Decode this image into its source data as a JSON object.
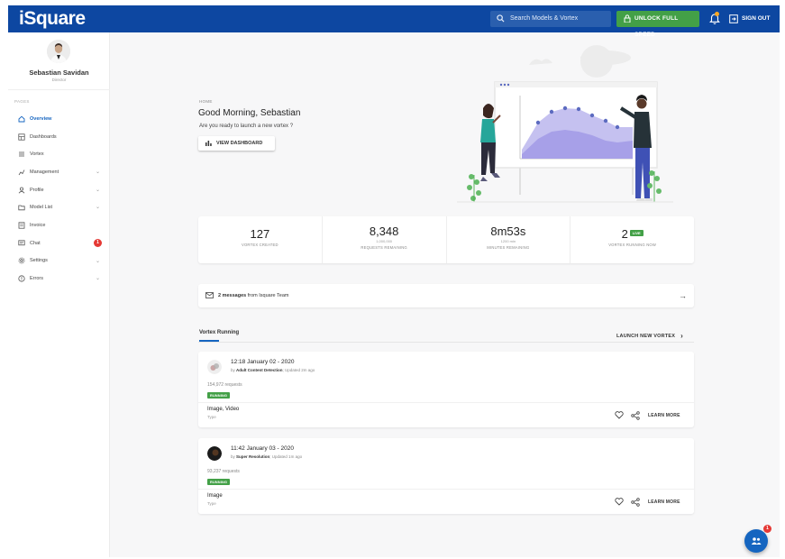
{
  "app": {
    "logo": "iSquare"
  },
  "topbar": {
    "search_placeholder": "Search Models & Vortex",
    "unlock_label": "UNLOCK FULL SPEED",
    "signout_label": "SIGN OUT",
    "colors": {
      "bar": "#0d47a1",
      "unlock": "#43a047"
    }
  },
  "user": {
    "name": "Sebastian Savidan",
    "role": "Director"
  },
  "sidebar": {
    "section_label": "PAGES",
    "items": [
      {
        "label": "Overview",
        "icon": "home-icon",
        "active": true
      },
      {
        "label": "Dashboards",
        "icon": "dashboard-icon"
      },
      {
        "label": "Vortex",
        "icon": "vortex-icon"
      },
      {
        "label": "Management",
        "icon": "management-icon",
        "chevron": true
      },
      {
        "label": "Profile",
        "icon": "profile-icon",
        "chevron": true
      },
      {
        "label": "Model List",
        "icon": "folder-icon",
        "chevron": true
      },
      {
        "label": "Invoice",
        "icon": "invoice-icon"
      },
      {
        "label": "Chat",
        "icon": "chat-icon",
        "badge": "1"
      },
      {
        "label": "Settings",
        "icon": "settings-icon",
        "chevron": true
      },
      {
        "label": "Errors",
        "icon": "error-icon",
        "chevron": true
      }
    ]
  },
  "hero": {
    "breadcrumb": "HOME",
    "greeting": "Good Morning, Sebastian",
    "question": "Are you ready to launch a new vortex ?",
    "view_button": "VIEW DASHBOARD"
  },
  "stats": [
    {
      "value": "127",
      "sub": "",
      "label": "VORTEX CREATED"
    },
    {
      "value": "8,348",
      "sub": "1,000,000",
      "label": "REQUESTS REMAINING"
    },
    {
      "value": "8m53s",
      "sub": "1200 min",
      "label": "MINUTES REMAINING"
    },
    {
      "value": "2",
      "badge": "LIVE",
      "sub": "",
      "label": "VORTEX RUNNING NOW"
    }
  ],
  "messages": {
    "count_text": "2 messages",
    "suffix": " from Isquare Team"
  },
  "tabs": {
    "running": "Vortex Running",
    "launch": "LAUNCH NEW VORTEX"
  },
  "cards": [
    {
      "time": "12:18 January 02 - 2020",
      "by": "by",
      "model": "Adult Content Detection",
      "updated": "; Updated 2m ago",
      "requests": "154,972 requests",
      "status": "RUNNING",
      "type_value": "Image, Video",
      "type_label": "Type",
      "learn_more": "LEARN MORE"
    },
    {
      "time": "11:42 January 03 - 2020",
      "by": "by",
      "model": "Super Resolution",
      "updated": "; Updated 1m ago",
      "requests": "93,237 requests",
      "status": "RUNNING",
      "type_value": "Image",
      "type_label": "Type",
      "learn_more": "LEARN MORE"
    }
  ],
  "fab": {
    "badge": "1"
  }
}
